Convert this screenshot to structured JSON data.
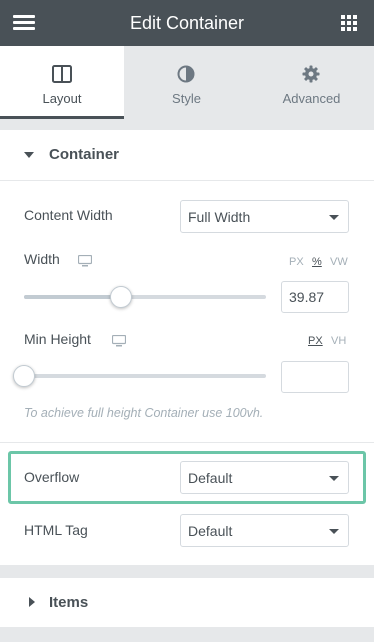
{
  "header": {
    "title": "Edit Container",
    "menu_icon": "hamburger-icon",
    "apps_icon": "grid-icon"
  },
  "tabs": [
    {
      "label": "Layout",
      "icon": "layout-icon",
      "active": true
    },
    {
      "label": "Style",
      "icon": "half-circle-icon",
      "active": false
    },
    {
      "label": "Advanced",
      "icon": "gear-icon",
      "active": false
    }
  ],
  "container_section": {
    "title": "Container",
    "content_width": {
      "label": "Content Width",
      "value": "Full Width"
    },
    "width": {
      "label": "Width",
      "units": [
        "PX",
        "%",
        "VW"
      ],
      "active_unit": "%",
      "value": "39.87"
    },
    "min_height": {
      "label": "Min Height",
      "units": [
        "PX",
        "VH"
      ],
      "active_unit": "PX",
      "value": ""
    },
    "hint": "To achieve full height Container use 100vh.",
    "overflow": {
      "label": "Overflow",
      "value": "Default"
    },
    "html_tag": {
      "label": "HTML Tag",
      "value": "Default"
    }
  },
  "items_section": {
    "title": "Items"
  },
  "colors": {
    "header_bg": "#495157",
    "highlight": "#6cc6a8",
    "panel_bg": "#ffffff",
    "page_bg": "#e6e8ea"
  }
}
